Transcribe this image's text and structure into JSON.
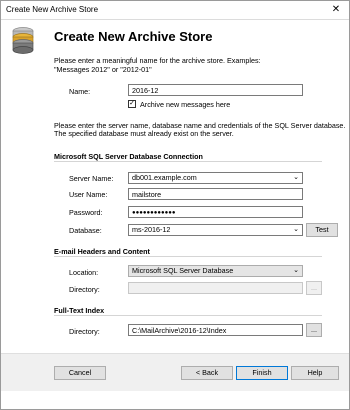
{
  "window": {
    "title": "Create New Archive Store",
    "close_glyph": "✕"
  },
  "header": {
    "title": "Create New Archive Store",
    "icon": "database-stack-icon"
  },
  "intro": {
    "line1": "Please enter a meaningful name for the archive store. Examples:",
    "line2": "\"Messages 2012\" or \"2012-01\""
  },
  "name": {
    "label": "Name:",
    "value": "2016-12"
  },
  "archive_new": {
    "label": "Archive new messages here",
    "checked": true
  },
  "db_info": {
    "line1": "Please enter the server name, database name and credentials of the SQL Server database.",
    "line2": "The specified database must already exist on the server."
  },
  "sql_section": {
    "title": "Microsoft SQL Server Database Connection",
    "server_label": "Server Name:",
    "server_value": "db001.example.com",
    "user_label": "User Name:",
    "user_value": "mailstore",
    "password_label": "Password:",
    "password_value": "●●●●●●●●●●●●",
    "database_label": "Database:",
    "database_value": "ms-2016-12",
    "test_label": "Test"
  },
  "email_section": {
    "title": "E-mail Headers and Content",
    "location_label": "Location:",
    "location_value": "Microsoft SQL Server Database",
    "directory_label": "Directory:",
    "directory_value": "",
    "browse_label": "..."
  },
  "fulltext_section": {
    "title": "Full-Text Index",
    "directory_label": "Directory:",
    "directory_value": "C:\\MailArchive\\2016-12\\Index",
    "browse_label": "..."
  },
  "footer": {
    "cancel": "Cancel",
    "back": "< Back",
    "finish": "Finish",
    "help": "Help"
  }
}
